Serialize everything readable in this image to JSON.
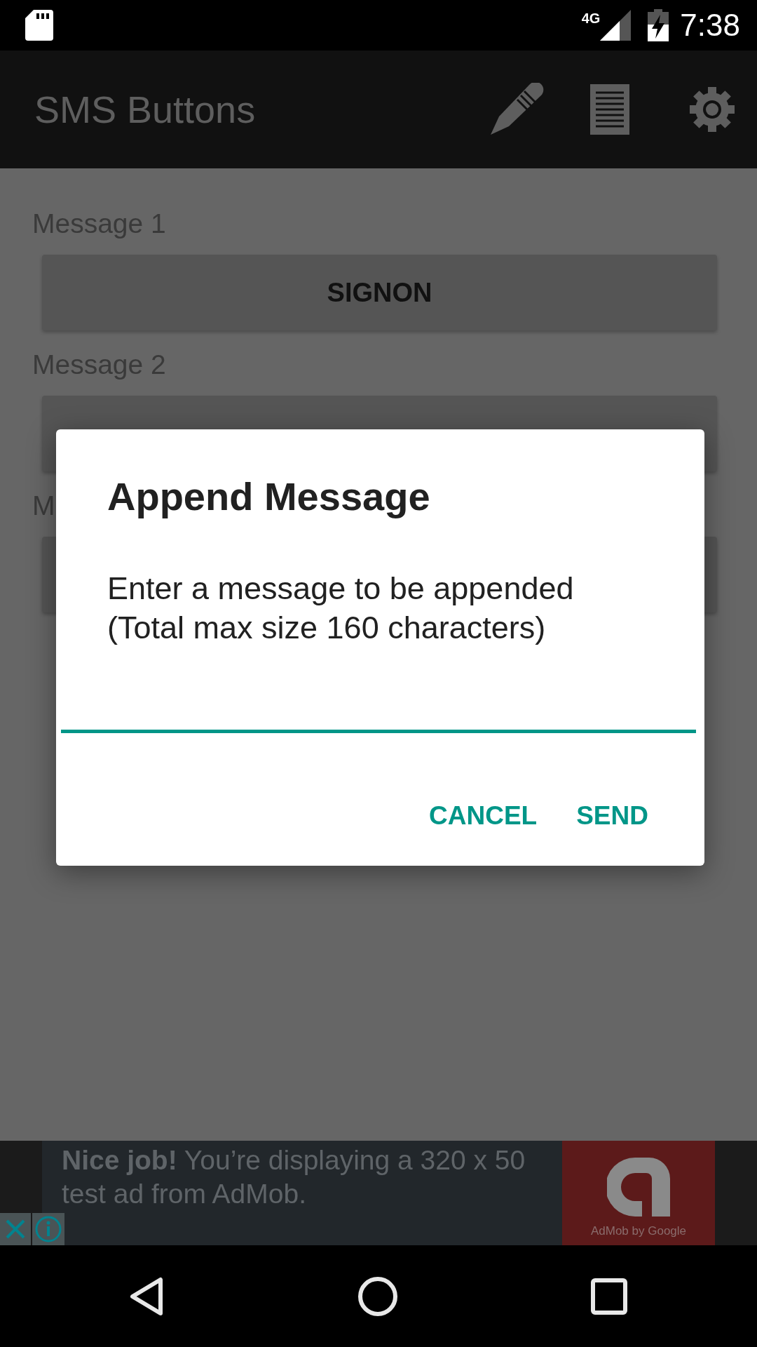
{
  "status_bar": {
    "network": "4G",
    "time": "7:38"
  },
  "app_bar": {
    "title": "SMS Buttons"
  },
  "messages": [
    {
      "label": "Message 1",
      "button": "SIGNON"
    },
    {
      "label": "Message 2"
    },
    {
      "label": "M"
    }
  ],
  "dialog": {
    "title": "Append Message",
    "message": "Enter a message to be appended\n(Total max size 160 characters)",
    "buttons": [
      "CANCEL",
      "SEND"
    ]
  },
  "ad": {
    "text": "**Nice job!** You’re displaying a 320 x 50 test ad from AdMob.",
    "brand": "AdMob by Google"
  }
}
